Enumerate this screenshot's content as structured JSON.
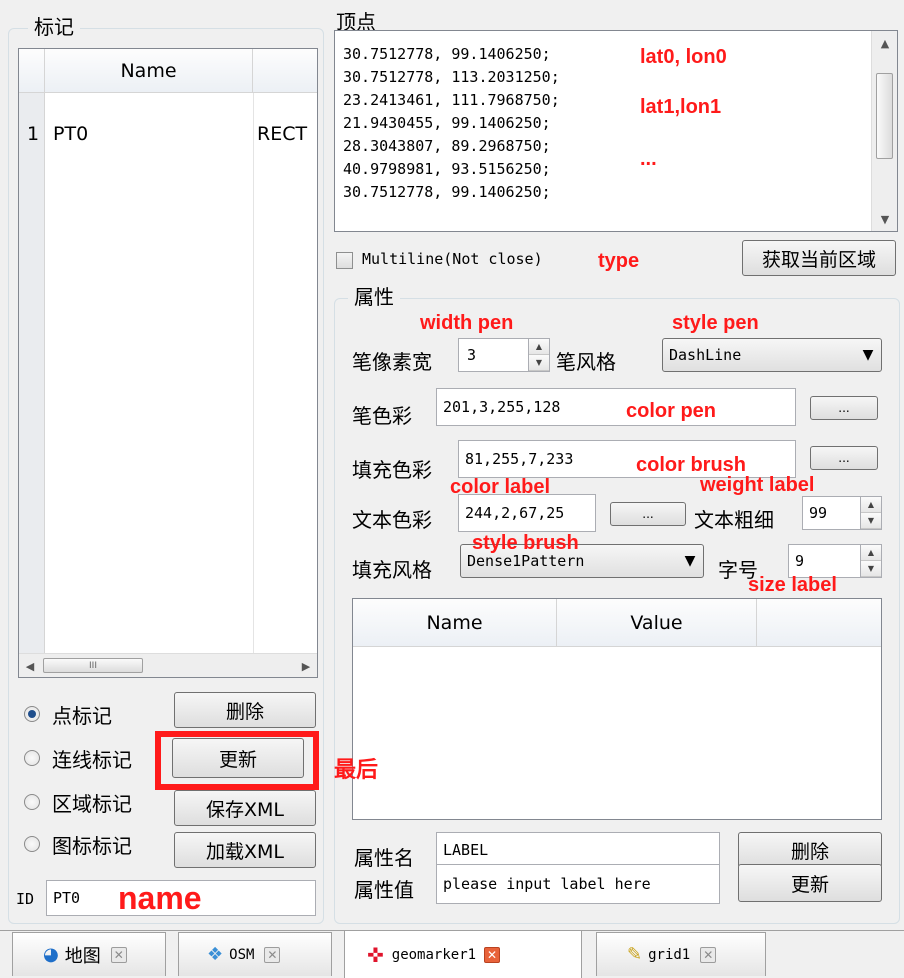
{
  "markers": {
    "group_title": "标记",
    "table": {
      "col_name": "Name",
      "rows": [
        {
          "index": "1",
          "name": "PT0",
          "type": "RECT"
        }
      ],
      "hscroll_thumb": "III"
    },
    "radios": [
      {
        "label": "点标记",
        "checked": true
      },
      {
        "label": "连线标记",
        "checked": false
      },
      {
        "label": "区域标记",
        "checked": false
      },
      {
        "label": "图标标记",
        "checked": false
      }
    ],
    "buttons": {
      "delete": "删除",
      "update": "更新",
      "save_xml": "保存XML",
      "load_xml": "加载XML"
    },
    "id_label": "ID",
    "id_value": "PT0"
  },
  "vertices": {
    "title": "顶点",
    "lines": [
      "30.7512778, 99.1406250;",
      "30.7512778, 113.2031250;",
      "23.2413461, 111.7968750;",
      "21.9430455, 99.1406250;",
      "28.3043807, 89.2968750;",
      "40.9798981, 93.5156250;",
      "30.7512778, 99.1406250;"
    ],
    "multiline_label": "Multiline(Not close)",
    "multiline_checked": false,
    "get_region_button": "获取当前区域"
  },
  "properties": {
    "group_title": "属性",
    "pen_width_label": "笔像素宽",
    "pen_width_value": "3",
    "pen_style_label": "笔风格",
    "pen_style_value": "DashLine",
    "pen_color_label": "笔色彩",
    "pen_color_value": "201,3,255,128",
    "brush_color_label": "填充色彩",
    "brush_color_value": "81,255,7,233",
    "text_color_label": "文本色彩",
    "text_color_value": "244,2,67,25",
    "text_weight_label": "文本粗细",
    "text_weight_value": "99",
    "brush_style_label": "填充风格",
    "brush_style_value": "Dense1Pattern",
    "font_size_label": "字号",
    "font_size_value": "9",
    "ellipsis": "...",
    "table": {
      "col_name": "Name",
      "col_value": "Value"
    },
    "attr_name_label": "属性名",
    "attr_name_value": "LABEL",
    "attr_value_label": "属性值",
    "attr_value_value": "please input label here",
    "delete_button": "删除",
    "update_button": "更新"
  },
  "annotations": {
    "lat0": "lat0, lon0",
    "lat1": "lat1,lon1",
    "dots": "...",
    "type": "type",
    "width_pen": "width pen",
    "style_pen": "style pen",
    "color_pen": "color pen",
    "color_brush": "color brush",
    "color_label": "color label",
    "weight_label": "weight label",
    "style_brush": "style brush",
    "size_label": "size label",
    "last": "最后",
    "name": "name",
    "annotation_color": "#ff1a1a"
  },
  "tabs": [
    {
      "label": "地图",
      "icon": "globe-icon",
      "active": false
    },
    {
      "label": "OSM",
      "icon": "map-tiles-icon",
      "active": false
    },
    {
      "label": "geomarker1",
      "icon": "crosshair-icon",
      "active": true
    },
    {
      "label": "grid1",
      "icon": "pencil-grid-icon",
      "active": false
    }
  ]
}
